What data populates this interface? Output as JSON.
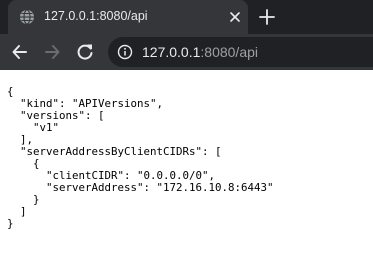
{
  "tab": {
    "title": "127.0.0.1:8080/api",
    "favicon_icon": "globe-icon",
    "close_icon": "close-icon"
  },
  "new_tab_icon": "plus-icon",
  "toolbar": {
    "back_icon": "arrow-left-icon",
    "forward_icon": "arrow-right-icon",
    "reload_icon": "reload-icon",
    "site_info_icon": "info-icon",
    "url_host": "127.0.0.1",
    "url_rest": ":8080/api"
  },
  "page": {
    "json_text": "{\n  \"kind\": \"APIVersions\",\n  \"versions\": [\n    \"v1\"\n  ],\n  \"serverAddressByClientCIDRs\": [\n    {\n      \"clientCIDR\": \"0.0.0.0/0\",\n      \"serverAddress\": \"172.16.10.8:6443\"\n    }\n  ]\n}"
  },
  "colors": {
    "tabstrip_bg": "#202124",
    "tab_bg": "#35363a",
    "omnibox_bg": "#202124",
    "text_light": "#e8eaed",
    "text_dim": "#9aa0a6",
    "forward_disabled": "#6b6c70"
  }
}
